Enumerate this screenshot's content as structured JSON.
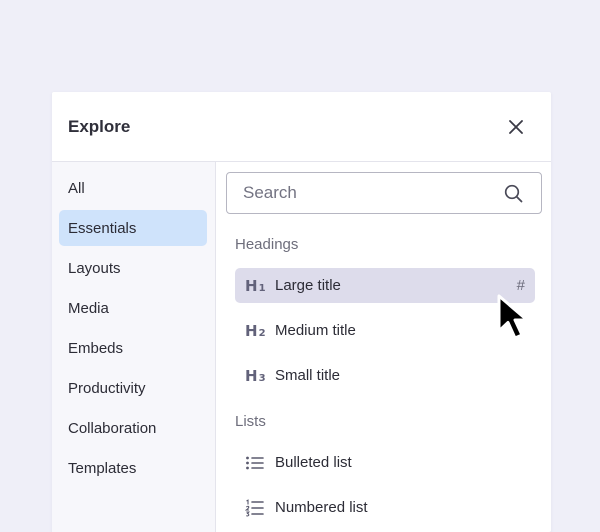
{
  "panel": {
    "title": "Explore",
    "close_icon": "close-icon"
  },
  "sidebar": {
    "items": [
      {
        "label": "All",
        "active": false
      },
      {
        "label": "Essentials",
        "active": true
      },
      {
        "label": "Layouts",
        "active": false
      },
      {
        "label": "Media",
        "active": false
      },
      {
        "label": "Embeds",
        "active": false
      },
      {
        "label": "Productivity",
        "active": false
      },
      {
        "label": "Collaboration",
        "active": false
      },
      {
        "label": "Templates",
        "active": false
      }
    ]
  },
  "search": {
    "placeholder": "Search",
    "icon": "search-icon"
  },
  "sections": {
    "headings": {
      "label": "Headings",
      "items": [
        {
          "icon_letter": "H",
          "icon_num": "1",
          "label": "Large title",
          "shortcut": "#"
        },
        {
          "icon_letter": "H",
          "icon_num": "2",
          "label": "Medium title"
        },
        {
          "icon_letter": "H",
          "icon_num": "3",
          "label": "Small title"
        }
      ]
    },
    "lists": {
      "label": "Lists",
      "items": [
        {
          "icon": "bulleted-list-icon",
          "label": "Bulleted list"
        },
        {
          "icon": "numbered-list-icon",
          "label": "Numbered list"
        }
      ]
    }
  },
  "colors": {
    "background": "#efeff8",
    "active_sidebar": "#cfe3fb",
    "hover_row": "#dddceb",
    "text": "#2c2c36"
  }
}
